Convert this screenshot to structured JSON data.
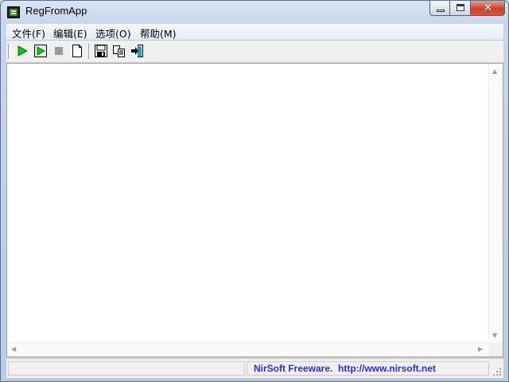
{
  "window": {
    "title": "RegFromApp",
    "close_glyph": "✕"
  },
  "menu": {
    "items": [
      {
        "label": "文件(F)"
      },
      {
        "label": "编辑(E)"
      },
      {
        "label": "选项(O)"
      },
      {
        "label": "帮助(M)"
      }
    ]
  },
  "toolbar": {
    "buttons": [
      {
        "icon": "start-icon",
        "color": "#16c216"
      },
      {
        "icon": "start-process-icon",
        "color": "#16c216"
      },
      {
        "icon": "stop-icon",
        "color": "#9a9a9a"
      },
      {
        "icon": "new-document-icon"
      },
      {
        "icon": "save-icon"
      },
      {
        "icon": "copy-icon"
      },
      {
        "icon": "exit-icon",
        "color": "#1f9fbf"
      }
    ]
  },
  "statusbar": {
    "left_text": "",
    "right_text": "NirSoft Freeware.  http://www.nirsoft.net",
    "link_color": "#2b2bd6"
  }
}
